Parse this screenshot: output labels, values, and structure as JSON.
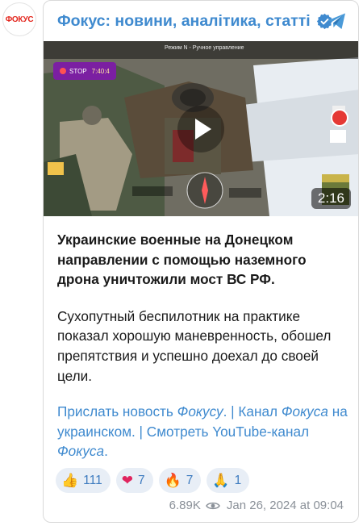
{
  "avatar": {
    "logo_text": "ФОКУС"
  },
  "header": {
    "title": "Фокус: новини, аналітика, статті",
    "verified_icon": "verified-check-icon",
    "share_icon": "telegram-share-icon"
  },
  "video": {
    "duration": "2:16",
    "hud_mode": "Режим N - Ручное управление",
    "hud_stop": "STOP",
    "hud_time": "7:40:4"
  },
  "post": {
    "headline": "Украинские военные на Донецком направлении с помощью наземного дрона уничтожили мост ВС РФ.",
    "body": "Сухопутный беспилотник на практике показал хорошую маневренность, обошел препятствия и успешно доехал до своей цели."
  },
  "links": {
    "send_news_prefix": "Прислать новость ",
    "send_news_brand": "Фокусу",
    "send_news_suffix": ".",
    "separator": " | ",
    "channel_prefix": "Канал ",
    "channel_brand": "Фокуса",
    "channel_suffix": " на украинском.",
    "youtube_prefix": "Смотреть YouTube-канал ",
    "youtube_brand": "Фокуса",
    "youtube_suffix": "."
  },
  "reactions": [
    {
      "emoji": "👍",
      "icon": "thumbs-up-icon",
      "count": "111"
    },
    {
      "emoji": "❤",
      "icon": "heart-icon",
      "count": "7"
    },
    {
      "emoji": "🔥",
      "icon": "fire-icon",
      "count": "7"
    },
    {
      "emoji": "🙏",
      "icon": "pray-icon",
      "count": "1"
    }
  ],
  "meta": {
    "views": "6.89K",
    "date": "Jan 26, 2024 at 09:04"
  },
  "colors": {
    "accent": "#3f8acf",
    "reaction_bg": "#e8eef6",
    "brand_red": "#e3241b"
  }
}
